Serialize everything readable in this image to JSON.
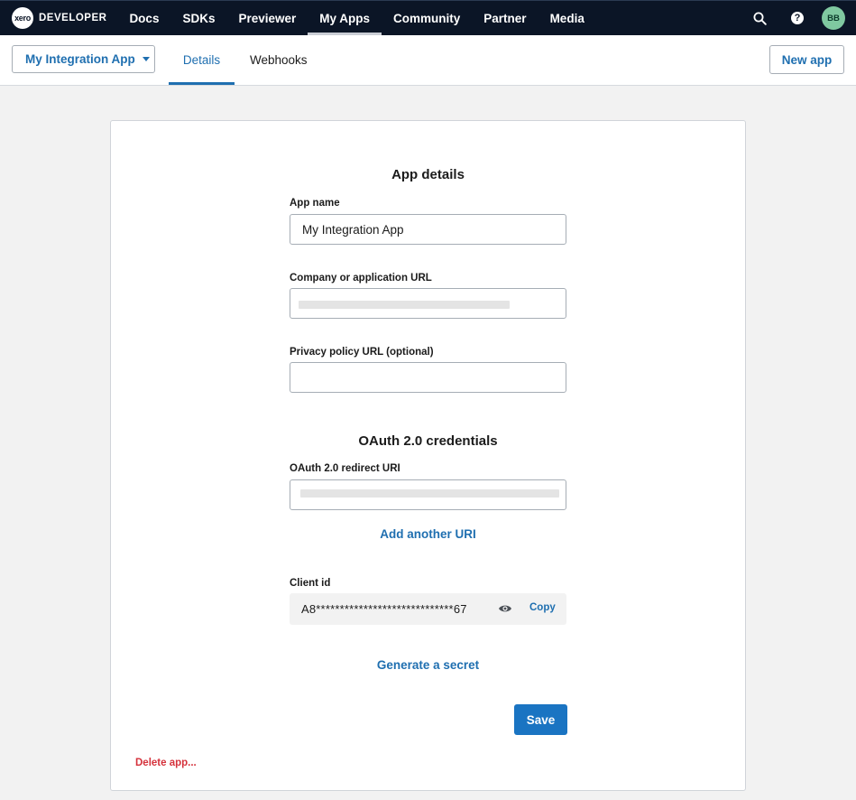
{
  "nav": {
    "logo_mark": "xero",
    "logo_text": "DEVELOPER",
    "links": [
      "Docs",
      "SDKs",
      "Previewer",
      "My Apps",
      "Community",
      "Partner",
      "Media"
    ],
    "active_link": "My Apps",
    "avatar_initials": "BB",
    "help_glyph": "?",
    "icons": [
      "search-icon",
      "help-icon"
    ]
  },
  "subheader": {
    "app_selector": "My Integration App",
    "tabs": [
      "Details",
      "Webhooks"
    ],
    "active_tab": "Details",
    "new_app_label": "New app"
  },
  "app_details": {
    "title": "App details",
    "app_name_label": "App name",
    "app_name_value": "My Integration App",
    "company_url_label": "Company or application URL",
    "privacy_url_label": "Privacy policy URL (optional)",
    "privacy_url_value": ""
  },
  "oauth": {
    "title": "OAuth 2.0 credentials",
    "redirect_label": "OAuth 2.0 redirect URI",
    "add_uri_label": "Add another URI",
    "client_id_label": "Client id",
    "client_id_value": "A8*****************************67",
    "copy_label": "Copy",
    "generate_secret_label": "Generate a secret"
  },
  "actions": {
    "save_label": "Save",
    "delete_label": "Delete app..."
  },
  "colors": {
    "nav_bg": "#0b1526",
    "accent": "#1f6fb0",
    "primary_button": "#1a74c2",
    "danger": "#d5323c",
    "avatar": "#7fc8a0"
  }
}
